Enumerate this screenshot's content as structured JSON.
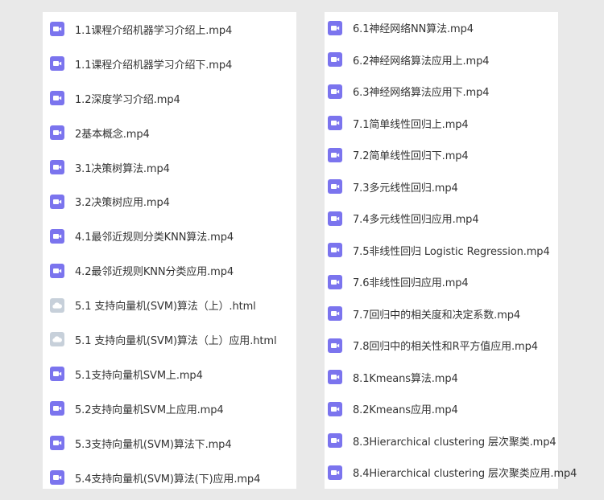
{
  "colors": {
    "background": "#e9e9e9",
    "panel": "#ffffff",
    "video_icon": "#7b74ee",
    "html_icon": "#c7d0da",
    "text": "#333333"
  },
  "left_files": [
    {
      "name": "1.1课程介绍机器学习介绍上.mp4",
      "icon": "video-file-icon"
    },
    {
      "name": "1.1课程介绍机器学习介绍下.mp4",
      "icon": "video-file-icon"
    },
    {
      "name": "1.2深度学习介绍.mp4",
      "icon": "video-file-icon"
    },
    {
      "name": "2基本概念.mp4",
      "icon": "video-file-icon"
    },
    {
      "name": "3.1决策树算法.mp4",
      "icon": "video-file-icon"
    },
    {
      "name": "3.2决策树应用.mp4",
      "icon": "video-file-icon"
    },
    {
      "name": "4.1最邻近规则分类KNN算法.mp4",
      "icon": "video-file-icon"
    },
    {
      "name": "4.2最邻近规则KNN分类应用.mp4",
      "icon": "video-file-icon"
    },
    {
      "name": "5.1 支持向量机(SVM)算法（上）.html",
      "icon": "html-file-icon"
    },
    {
      "name": "5.1 支持向量机(SVM)算法（上）应用.html",
      "icon": "html-file-icon"
    },
    {
      "name": "5.1支持向量机SVM上.mp4",
      "icon": "video-file-icon"
    },
    {
      "name": "5.2支持向量机SVM上应用.mp4",
      "icon": "video-file-icon"
    },
    {
      "name": "5.3支持向量机(SVM)算法下.mp4",
      "icon": "video-file-icon"
    },
    {
      "name": "5.4支持向量机(SVM)算法(下)应用.mp4",
      "icon": "video-file-icon"
    }
  ],
  "right_files": [
    {
      "name": "6.1神经网络NN算法.mp4",
      "icon": "video-file-icon"
    },
    {
      "name": "6.2神经网络算法应用上.mp4",
      "icon": "video-file-icon"
    },
    {
      "name": "6.3神经网络算法应用下.mp4",
      "icon": "video-file-icon"
    },
    {
      "name": "7.1简单线性回归上.mp4",
      "icon": "video-file-icon"
    },
    {
      "name": "7.2简单线性回归下.mp4",
      "icon": "video-file-icon"
    },
    {
      "name": "7.3多元线性回归.mp4",
      "icon": "video-file-icon"
    },
    {
      "name": "7.4多元线性回归应用.mp4",
      "icon": "video-file-icon"
    },
    {
      "name": "7.5非线性回归 Logistic Regression.mp4",
      "icon": "video-file-icon"
    },
    {
      "name": "7.6非线性回归应用.mp4",
      "icon": "video-file-icon"
    },
    {
      "name": "7.7回归中的相关度和决定系数.mp4",
      "icon": "video-file-icon"
    },
    {
      "name": "7.8回归中的相关性和R平方值应用.mp4",
      "icon": "video-file-icon"
    },
    {
      "name": "8.1Kmeans算法.mp4",
      "icon": "video-file-icon"
    },
    {
      "name": "8.2Kmeans应用.mp4",
      "icon": "video-file-icon"
    },
    {
      "name": "8.3Hierarchical clustering 层次聚类.mp4",
      "icon": "video-file-icon"
    },
    {
      "name": "8.4Hierarchical clustering 层次聚类应用.mp4",
      "icon": "video-file-icon"
    }
  ]
}
